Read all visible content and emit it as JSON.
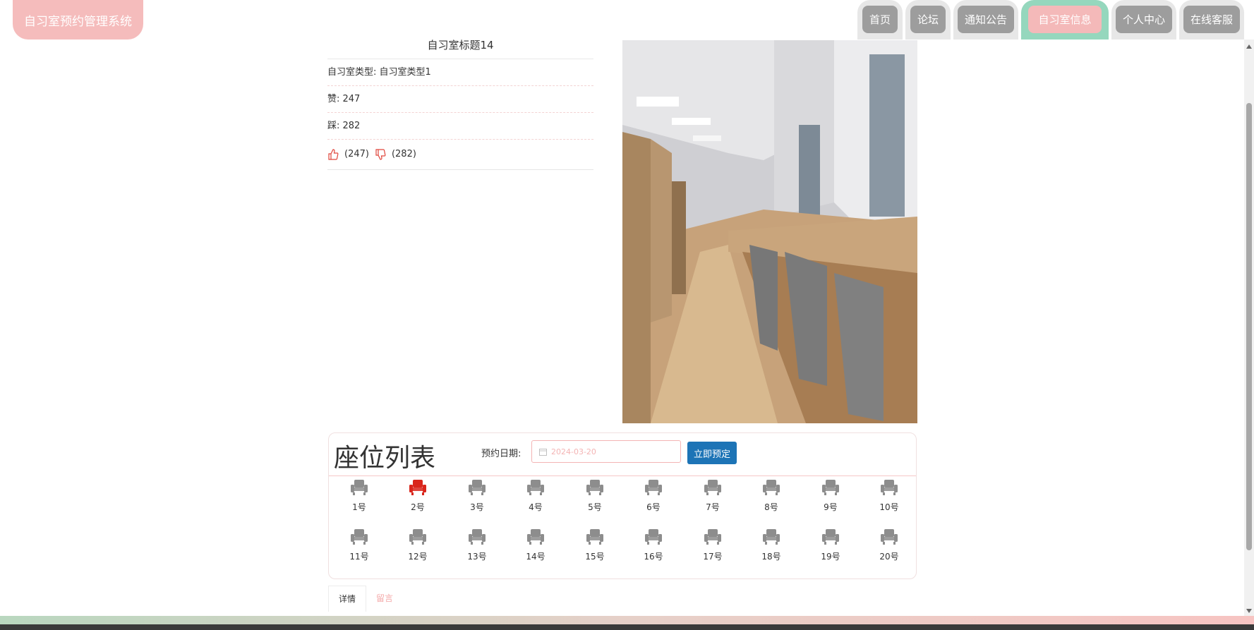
{
  "app": {
    "title": "自习室预约管理系统"
  },
  "nav": {
    "items": [
      {
        "label": "首页"
      },
      {
        "label": "论坛"
      },
      {
        "label": "通知公告"
      },
      {
        "label": "自习室信息",
        "active": true
      },
      {
        "label": "个人中心"
      },
      {
        "label": "在线客服"
      }
    ]
  },
  "room": {
    "title": "自习室标题14",
    "type_label": "自习室类型: 自习室类型1",
    "likes_label": "赞: 247",
    "dislikes_label": "踩: 282",
    "like_count": "(247)",
    "dislike_count": "(282)"
  },
  "seats": {
    "heading": "座位列表",
    "date_label": "预约日期:",
    "date_placeholder": "2024-03-20",
    "book_button": "立即预定",
    "items": [
      {
        "label": "1号",
        "status": "available"
      },
      {
        "label": "2号",
        "status": "selected"
      },
      {
        "label": "3号",
        "status": "available"
      },
      {
        "label": "4号",
        "status": "available"
      },
      {
        "label": "5号",
        "status": "available"
      },
      {
        "label": "6号",
        "status": "available"
      },
      {
        "label": "7号",
        "status": "available"
      },
      {
        "label": "8号",
        "status": "available"
      },
      {
        "label": "9号",
        "status": "available"
      },
      {
        "label": "10号",
        "status": "available"
      },
      {
        "label": "11号",
        "status": "available"
      },
      {
        "label": "12号",
        "status": "available"
      },
      {
        "label": "13号",
        "status": "available"
      },
      {
        "label": "14号",
        "status": "available"
      },
      {
        "label": "15号",
        "status": "available"
      },
      {
        "label": "16号",
        "status": "available"
      },
      {
        "label": "17号",
        "status": "available"
      },
      {
        "label": "18号",
        "status": "available"
      },
      {
        "label": "19号",
        "status": "available"
      },
      {
        "label": "20号",
        "status": "available"
      }
    ]
  },
  "tabs": [
    {
      "label": "详情",
      "active": true
    },
    {
      "label": "留言",
      "active": false
    }
  ],
  "colors": {
    "seat_available": "#8d8d8d",
    "seat_selected": "#d9261c",
    "accent_pink": "#f5bcbc",
    "accent_green": "#95d7bd",
    "button_blue": "#1d74b6"
  },
  "icons": {
    "like": "thumbs-up-icon",
    "dislike": "thumbs-down-icon",
    "seat": "armchair-icon",
    "calendar": "calendar-icon"
  }
}
